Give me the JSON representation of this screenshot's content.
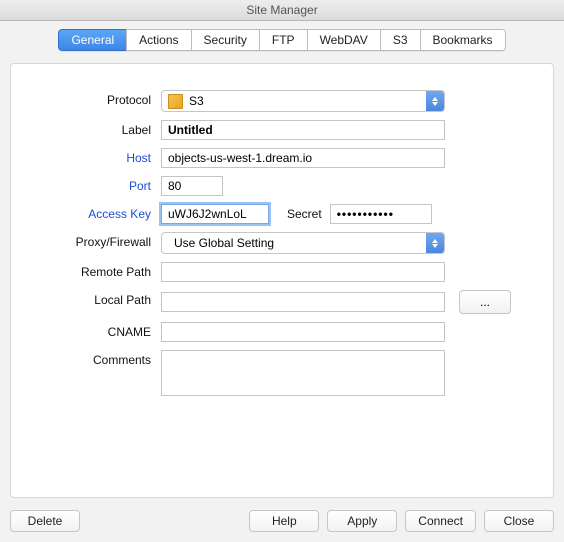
{
  "window": {
    "title": "Site Manager"
  },
  "tabs": {
    "items": [
      {
        "label": "General"
      },
      {
        "label": "Actions"
      },
      {
        "label": "Security"
      },
      {
        "label": "FTP"
      },
      {
        "label": "WebDAV"
      },
      {
        "label": "S3"
      },
      {
        "label": "Bookmarks"
      }
    ],
    "selected_index": 0
  },
  "labels": {
    "protocol": "Protocol",
    "label": "Label",
    "host": "Host",
    "port": "Port",
    "access_key": "Access Key",
    "secret": "Secret",
    "proxy": "Proxy/Firewall",
    "remote_path": "Remote Path",
    "local_path": "Local Path",
    "cname": "CNAME",
    "comments": "Comments"
  },
  "fields": {
    "protocol": {
      "icon": "cube-icon",
      "value": "S3"
    },
    "label": "Untitled",
    "host": "objects-us-west-1.dream.io",
    "port": "80",
    "access_key": "uWJ6J2wnLoL",
    "secret": "•••••••••••",
    "proxy": "Use Global Setting",
    "remote_path": "",
    "local_path": "",
    "cname": "",
    "comments": ""
  },
  "buttons": {
    "browse": "...",
    "delete": "Delete",
    "help": "Help",
    "apply": "Apply",
    "connect": "Connect",
    "close": "Close"
  }
}
